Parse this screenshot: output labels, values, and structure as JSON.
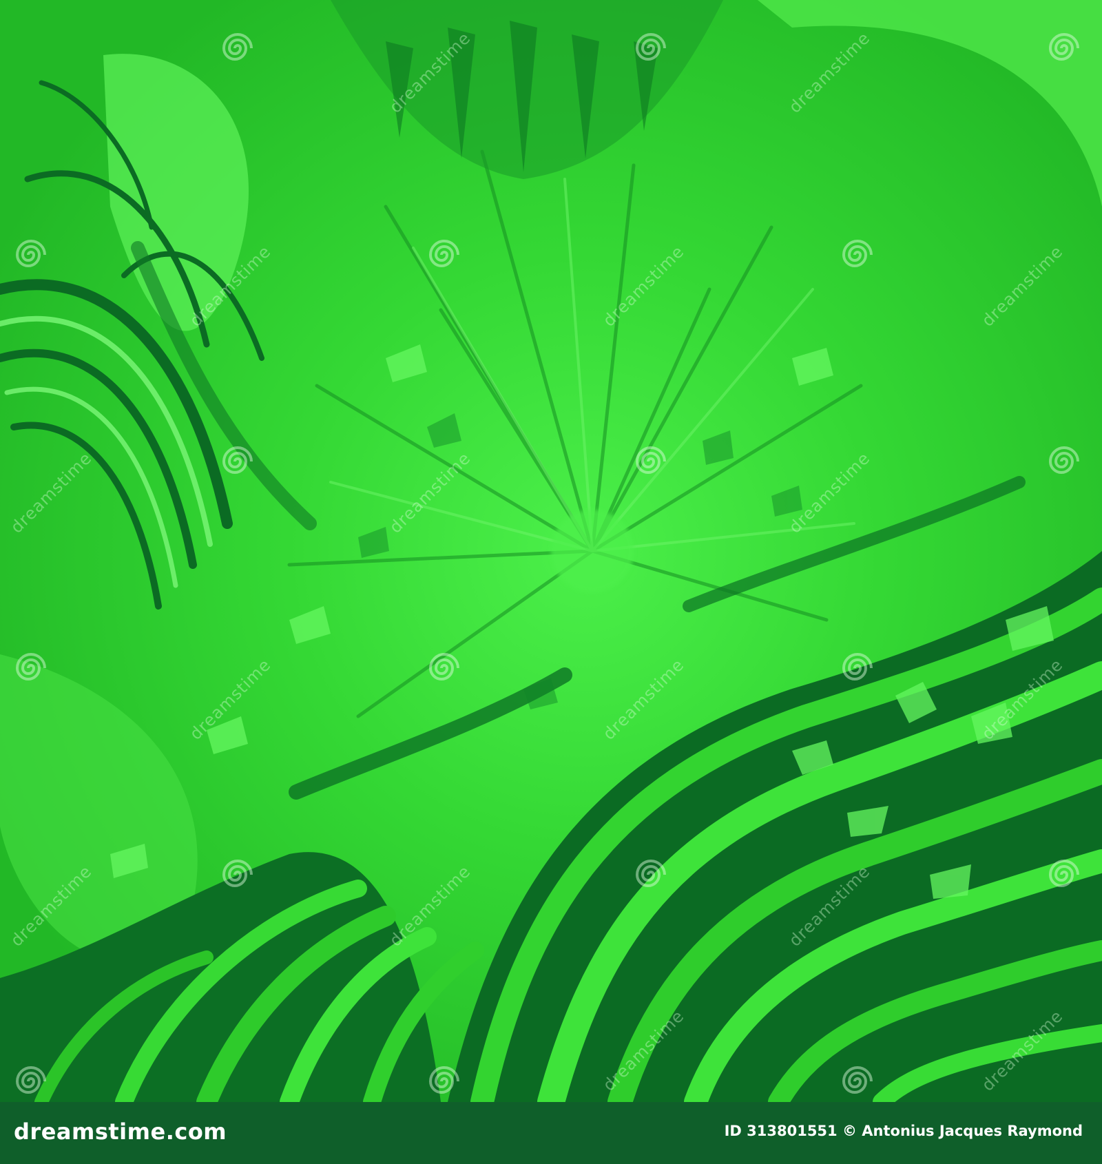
{
  "image": {
    "subject": "abstract",
    "palette": {
      "bright": "#39e63a",
      "mid": "#1fb81f",
      "dark": "#0b6b23",
      "footer": "#0f5f2a"
    }
  },
  "watermark": {
    "text": "dreamstime",
    "icon": "spiral-logo-icon"
  },
  "footer": {
    "brand": "dreamstime.com",
    "credit": "ID 313801551 © Antonius Jacques Raymond"
  }
}
